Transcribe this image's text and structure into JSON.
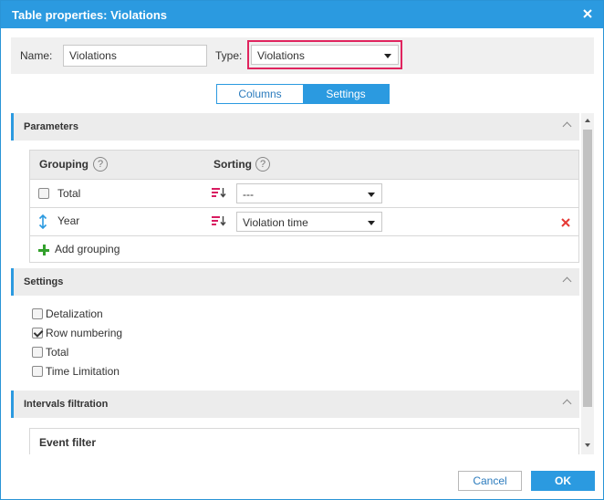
{
  "dialog": {
    "title": "Table properties: Violations",
    "close_icon": "close-icon"
  },
  "name_row": {
    "name_label": "Name:",
    "name_value": "Violations",
    "type_label": "Type:",
    "type_value": "Violations"
  },
  "tabs": [
    {
      "label": "Columns",
      "active": false
    },
    {
      "label": "Settings",
      "active": true
    }
  ],
  "sections": {
    "parameters": {
      "title": "Parameters",
      "grouping_header": "Grouping",
      "sorting_header": "Sorting",
      "help_glyph": "?",
      "rows": [
        {
          "label": "Total",
          "sort": "---",
          "icon": "checkbox"
        },
        {
          "label": "Year",
          "sort": "Violation time",
          "icon": "up-down-arrow-icon"
        }
      ],
      "add_grouping": "Add grouping"
    },
    "settings": {
      "title": "Settings",
      "options": [
        {
          "label": "Detalization",
          "checked": false
        },
        {
          "label": "Row numbering",
          "checked": true
        },
        {
          "label": "Total",
          "checked": false
        },
        {
          "label": "Time Limitation",
          "checked": false
        }
      ]
    },
    "intervals": {
      "title": "Intervals filtration",
      "event_filter": "Event filter"
    }
  },
  "footer": {
    "cancel_label": "Cancel",
    "ok_label": "OK"
  },
  "colors": {
    "accent": "#2b9ae0",
    "highlight_border": "#e0245e",
    "delete": "#e53935",
    "add": "#33a02c",
    "sort_icon": "#d81b60"
  }
}
